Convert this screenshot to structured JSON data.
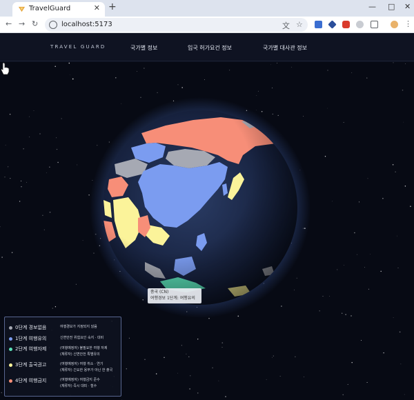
{
  "browser": {
    "tab_title": "TravelGuard",
    "tab_close": "✕",
    "new_tab": "+",
    "url": "localhost:5173",
    "minimize": "—",
    "maximize": "□",
    "close": "✕",
    "back": "←",
    "forward": "→",
    "reload": "↻",
    "translate_glyph": "文",
    "star_glyph": "☆",
    "menu_glyph": "⋮"
  },
  "header": {
    "logo": "TRAVEL GUARD",
    "nav": [
      {
        "label": "국가별 정보"
      },
      {
        "label": "입국 허가요건 정보"
      },
      {
        "label": "국가별 대사관 정보"
      }
    ]
  },
  "tooltip": {
    "country": "중국 (CN)",
    "level": "여행경보 1단계: 여행유의"
  },
  "legend": {
    "items": [
      {
        "label": "0단계 경보없음",
        "color": "#a6a9b3",
        "desc": [
          "여행경보가 지정되지 않음"
        ]
      },
      {
        "label": "1단계 여행유의",
        "color": "#7b9cf0",
        "desc": [
          "신변안전 위험요인 숙지 · 대비"
        ]
      },
      {
        "label": "2단계 여행자제",
        "color": "#5be0b8",
        "desc": [
          "(여행예정자) 불필요한 여행 자제",
          "(체류자) 신변안전 특별유의"
        ]
      },
      {
        "label": "3단계 출국권고",
        "color": "#fbf39a",
        "desc": [
          "(여행예정자) 여행 취소 · 연기",
          "(체류자) 긴요한 용무가 아닌 한 출국"
        ]
      },
      {
        "label": "4단계 여행금지",
        "color": "#f78e78",
        "desc": [
          "(여행예정자) 여행금지 준수",
          "(체류자) 즉시 대피 · 철수"
        ]
      }
    ]
  }
}
